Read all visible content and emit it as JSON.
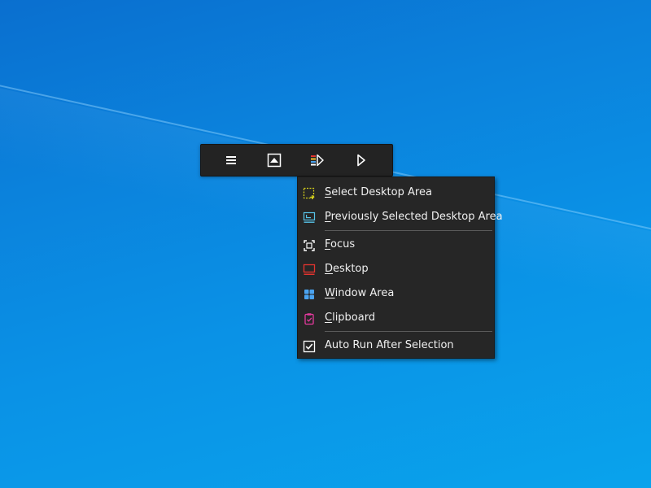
{
  "toolbar": {
    "buttons": [
      {
        "name": "menu",
        "icon": "hamburger-menu-icon"
      },
      {
        "name": "capture",
        "icon": "capture-region-icon"
      },
      {
        "name": "capture-mode",
        "icon": "capture-mode-icon"
      },
      {
        "name": "run",
        "icon": "play-icon"
      }
    ]
  },
  "menu": {
    "items": [
      {
        "label": "Select Desktop Area",
        "accel": "S",
        "rest": "elect Desktop Area",
        "icon": "select-area-icon",
        "icon_color": "#d8d31c"
      },
      {
        "label": "Previously Selected Desktop Area",
        "accel": "P",
        "rest": "reviously Selected Desktop Area",
        "icon": "previous-area-icon",
        "icon_color": "#57c3e8"
      },
      {
        "label": "Focus",
        "accel": "F",
        "rest": "ocus",
        "icon": "focus-icon",
        "icon_color": "#ffffff"
      },
      {
        "label": "Desktop",
        "accel": "D",
        "rest": "esktop",
        "icon": "desktop-icon",
        "icon_color": "#e3342f"
      },
      {
        "label": "Window Area",
        "accel": "W",
        "rest": "indow Area",
        "icon": "window-area-icon",
        "icon_color": "#4aa3f0"
      },
      {
        "label": "Clipboard",
        "accel": "C",
        "rest": "lipboard",
        "icon": "clipboard-icon",
        "icon_color": "#e43a9e"
      },
      {
        "label": "Auto Run After Selection",
        "accel": "",
        "rest": "Auto Run After Selection",
        "icon": "checkbox-checked-icon",
        "icon_color": "#ffffff",
        "checked": true
      }
    ]
  },
  "colors": {
    "desktop_bg": "#0b86df",
    "panel_bg": "#262626",
    "text": "#f0f0f0"
  }
}
